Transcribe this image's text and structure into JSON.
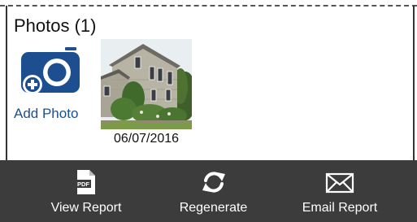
{
  "section": {
    "title": "Photos (1)"
  },
  "add_photo": {
    "label": "Add Photo",
    "icon": "camera-plus-icon",
    "color": "#1d4e8f"
  },
  "photos": [
    {
      "date": "06/07/2016"
    }
  ],
  "toolbar": {
    "background": "#3c3c3c",
    "buttons": [
      {
        "label": "View Report",
        "icon": "pdf-document-icon"
      },
      {
        "label": "Regenerate",
        "icon": "refresh-icon"
      },
      {
        "label": "Email Report",
        "icon": "envelope-icon"
      }
    ]
  },
  "pdf_icon_text": "PDF"
}
